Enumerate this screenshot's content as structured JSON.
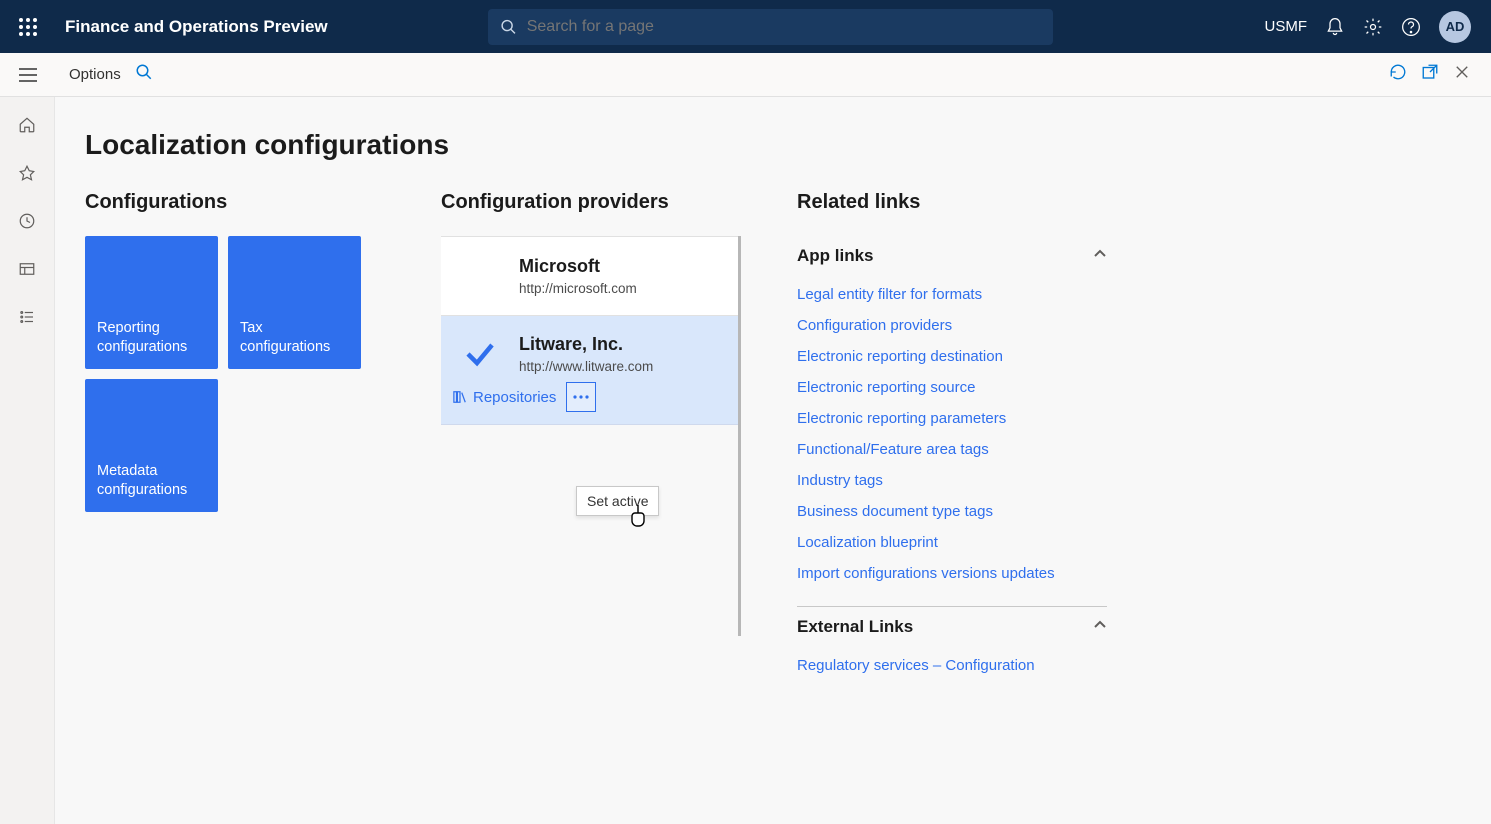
{
  "header": {
    "app_title": "Finance and Operations Preview",
    "search_placeholder": "Search for a page",
    "company": "USMF",
    "avatar_initials": "AD"
  },
  "subbar": {
    "options_label": "Options"
  },
  "page": {
    "title": "Localization configurations"
  },
  "configurations": {
    "heading": "Configurations",
    "tiles": [
      "Reporting configurations",
      "Tax configurations",
      "Metadata configurations"
    ]
  },
  "providers": {
    "heading": "Configuration providers",
    "items": [
      {
        "name": "Microsoft",
        "url": "http://microsoft.com",
        "selected": false
      },
      {
        "name": "Litware, Inc.",
        "url": "http://www.litware.com",
        "selected": true
      }
    ],
    "repositories_label": "Repositories",
    "popup_label": "Set active"
  },
  "related": {
    "heading": "Related links",
    "app_links_heading": "App links",
    "app_links": [
      "Legal entity filter for formats",
      "Configuration providers",
      "Electronic reporting destination",
      "Electronic reporting source",
      "Electronic reporting parameters",
      "Functional/Feature area tags",
      "Industry tags",
      "Business document type tags",
      "Localization blueprint",
      "Import configurations versions updates"
    ],
    "external_links_heading": "External Links",
    "external_links": [
      "Regulatory services – Configuration"
    ]
  }
}
